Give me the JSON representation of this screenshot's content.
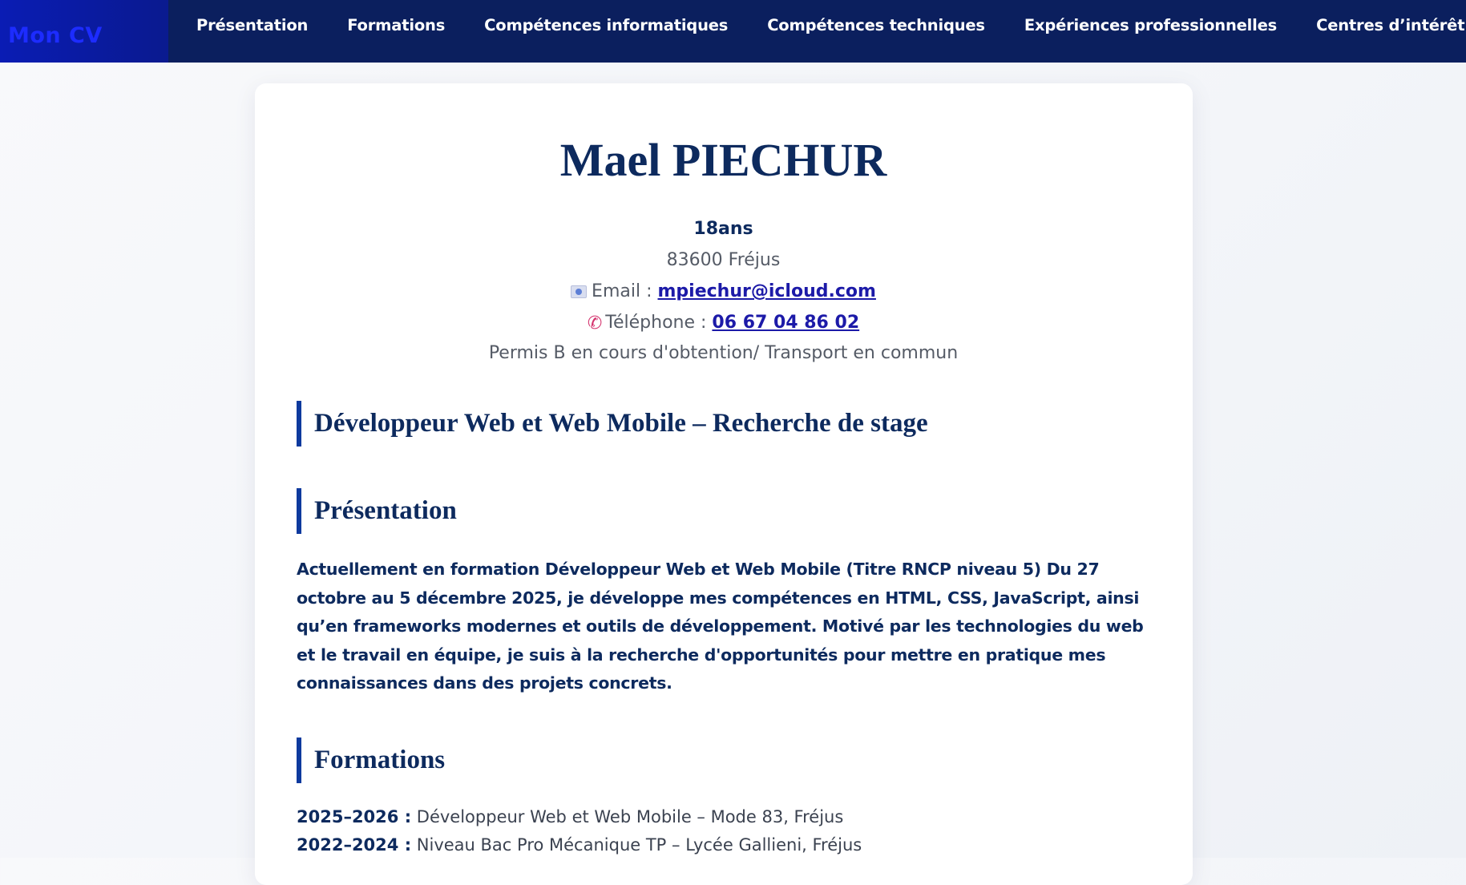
{
  "brand": "Mon CV",
  "nav": {
    "items": [
      "Présentation",
      "Formations",
      "Compétences informatiques",
      "Compétences techniques",
      "Expériences professionnelles",
      "Centres d’intérêt"
    ]
  },
  "profile": {
    "name": "Mael PIECHUR",
    "age": "18ans",
    "city": "83600 Fréjus",
    "email_label": "Email :",
    "email": "mpiechur@icloud.com",
    "phone_label": "Téléphone :",
    "phone": "06 67 04 86 02",
    "permis": "Permis B en cours d'obtention/ Transport en commun"
  },
  "headline": "Développeur Web et Web Mobile – Recherche de stage",
  "presentation": {
    "title": "Présentation",
    "text": "Actuellement en formation Développeur Web et Web Mobile (Titre RNCP niveau 5) Du 27 octobre au 5 décembre 2025, je développe mes compétences en HTML, CSS, JavaScript, ainsi qu’en frameworks modernes et outils de développement. Motivé par les technologies du web et le travail en équipe, je suis à la recherche d'opportunités pour mettre en pratique mes connaissances dans des projets concrets."
  },
  "formations": {
    "title": "Formations",
    "items": [
      {
        "years": "2025–2026 :",
        "desc": " Développeur Web et Web Mobile – Mode 83, Fréjus"
      },
      {
        "years": "2022–2024 :",
        "desc": " Niveau Bac Pro Mécanique TP – Lycée Gallieni, Fréjus"
      }
    ]
  },
  "colors": {
    "navbar": "#0b1f5e",
    "brand_bg": "#0a1cb4",
    "brand_text": "#1d2cff",
    "heading": "#0d2a5e",
    "accent_border": "#0e3a9e",
    "link": "#1c1aa8"
  },
  "icons": {
    "email": "email-icon",
    "phone": "phone-icon"
  }
}
